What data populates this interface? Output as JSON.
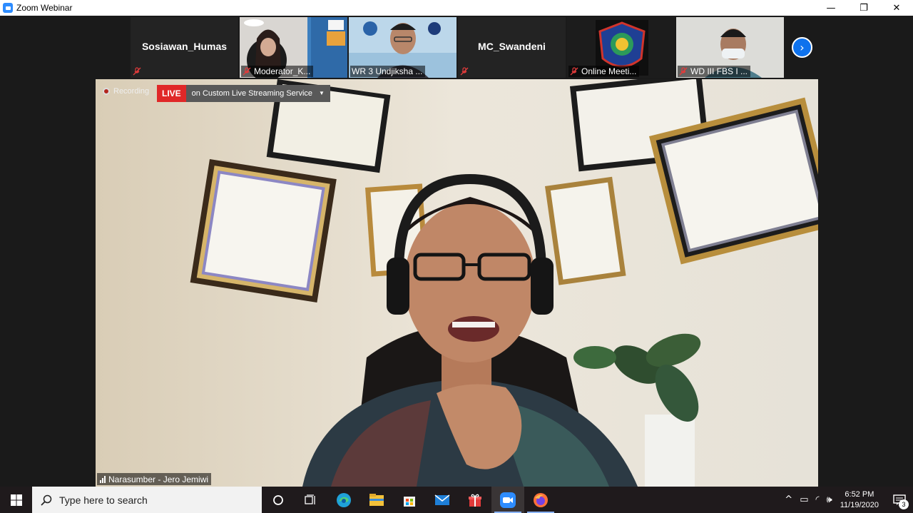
{
  "window": {
    "title": "Zoom Webinar",
    "controls": {
      "minimize": "—",
      "restore": "❐",
      "close": "✕"
    }
  },
  "thumbnails": [
    {
      "type": "name",
      "name": "Sosiawan_Humas",
      "muted": true
    },
    {
      "type": "video",
      "name": "Moderator_K...",
      "muted": true,
      "bg": "#3b7ab8"
    },
    {
      "type": "video",
      "name": "WR 3 Undjiksha ...",
      "muted": false,
      "bg": "#b9d5e8"
    },
    {
      "type": "name",
      "name": "MC_Swandeni",
      "muted": true
    },
    {
      "type": "video",
      "name": "Online Meeti...",
      "muted": true,
      "bg": "#1f1f1f"
    },
    {
      "type": "video",
      "name": "WD III FBS I ...",
      "muted": true,
      "bg": "#d8d8d4"
    }
  ],
  "next_button": {
    "icon": "chevron-right-icon",
    "glyph": "›"
  },
  "main_video": {
    "recording_label": "Recording",
    "live_badge": "LIVE",
    "live_service": "on Custom Live Streaming Service",
    "speaker_name": "Narasumber - Jero Jemiwi"
  },
  "taskbar": {
    "search_placeholder": "Type here to search",
    "clock_time": "6:52 PM",
    "clock_date": "11/19/2020",
    "notification_count": "3"
  }
}
